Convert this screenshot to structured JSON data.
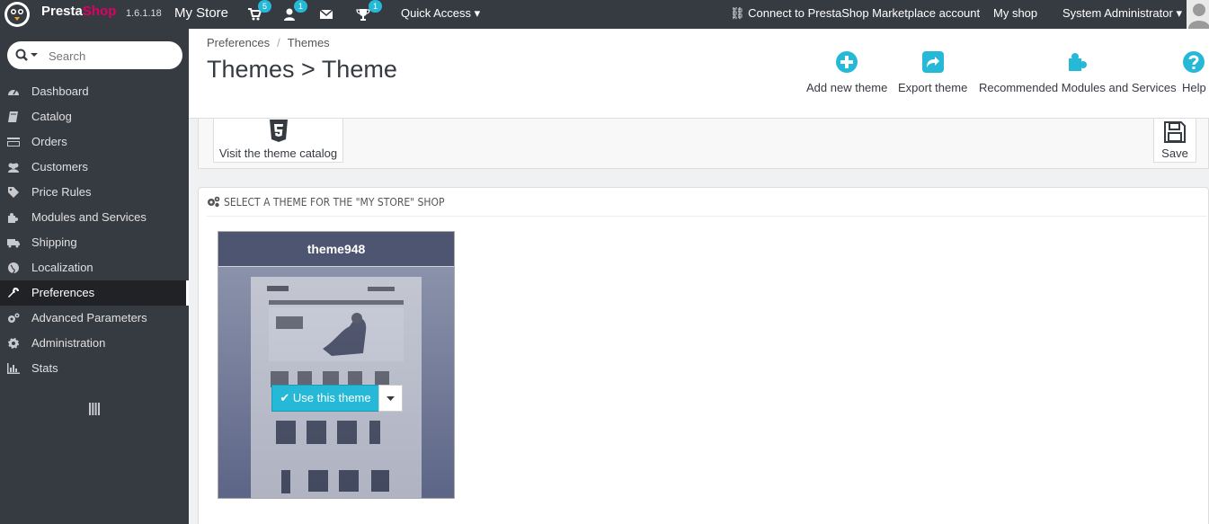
{
  "topbar": {
    "brand_presta": "Presta",
    "brand_shop": "Shop",
    "version": "1.6.1.18",
    "store_name": "My Store",
    "badges": {
      "orders": "5",
      "customers": "1",
      "messages": "",
      "trophy": "1"
    },
    "quick_access": "Quick Access",
    "connect": "Connect to PrestaShop Marketplace account",
    "my_shop": "My shop",
    "user": "System Administrator"
  },
  "sidebar": {
    "search_placeholder": "Search",
    "items": [
      {
        "label": "Dashboard",
        "icon": "dashboard-icon"
      },
      {
        "label": "Catalog",
        "icon": "book-icon"
      },
      {
        "label": "Orders",
        "icon": "credit-card-icon"
      },
      {
        "label": "Customers",
        "icon": "users-icon"
      },
      {
        "label": "Price Rules",
        "icon": "tags-icon"
      },
      {
        "label": "Modules and Services",
        "icon": "puzzle-icon"
      },
      {
        "label": "Shipping",
        "icon": "truck-icon"
      },
      {
        "label": "Localization",
        "icon": "globe-icon"
      },
      {
        "label": "Preferences",
        "icon": "wrench-icon",
        "active": true
      },
      {
        "label": "Advanced Parameters",
        "icon": "cogs-icon"
      },
      {
        "label": "Administration",
        "icon": "cog-icon"
      },
      {
        "label": "Stats",
        "icon": "bar-chart-icon"
      }
    ]
  },
  "header": {
    "breadcrumb": [
      "Preferences",
      "Themes"
    ],
    "title": "Themes > Theme",
    "toolbar": {
      "add_new_theme": "Add new theme",
      "export_theme": "Export theme",
      "recommended": "Recommended Modules and Services",
      "help": "Help"
    }
  },
  "subtoolbar": {
    "visit_catalog": "Visit the theme catalog",
    "save": "Save"
  },
  "panel": {
    "heading": "SELECT A THEME FOR THE \"MY STORE\" SHOP",
    "theme": {
      "name": "theme948",
      "use_button": "Use this theme"
    }
  },
  "colors": {
    "topbar_bg": "#363a41",
    "accent": "#25b9d7",
    "brand_pink": "#df0067"
  }
}
